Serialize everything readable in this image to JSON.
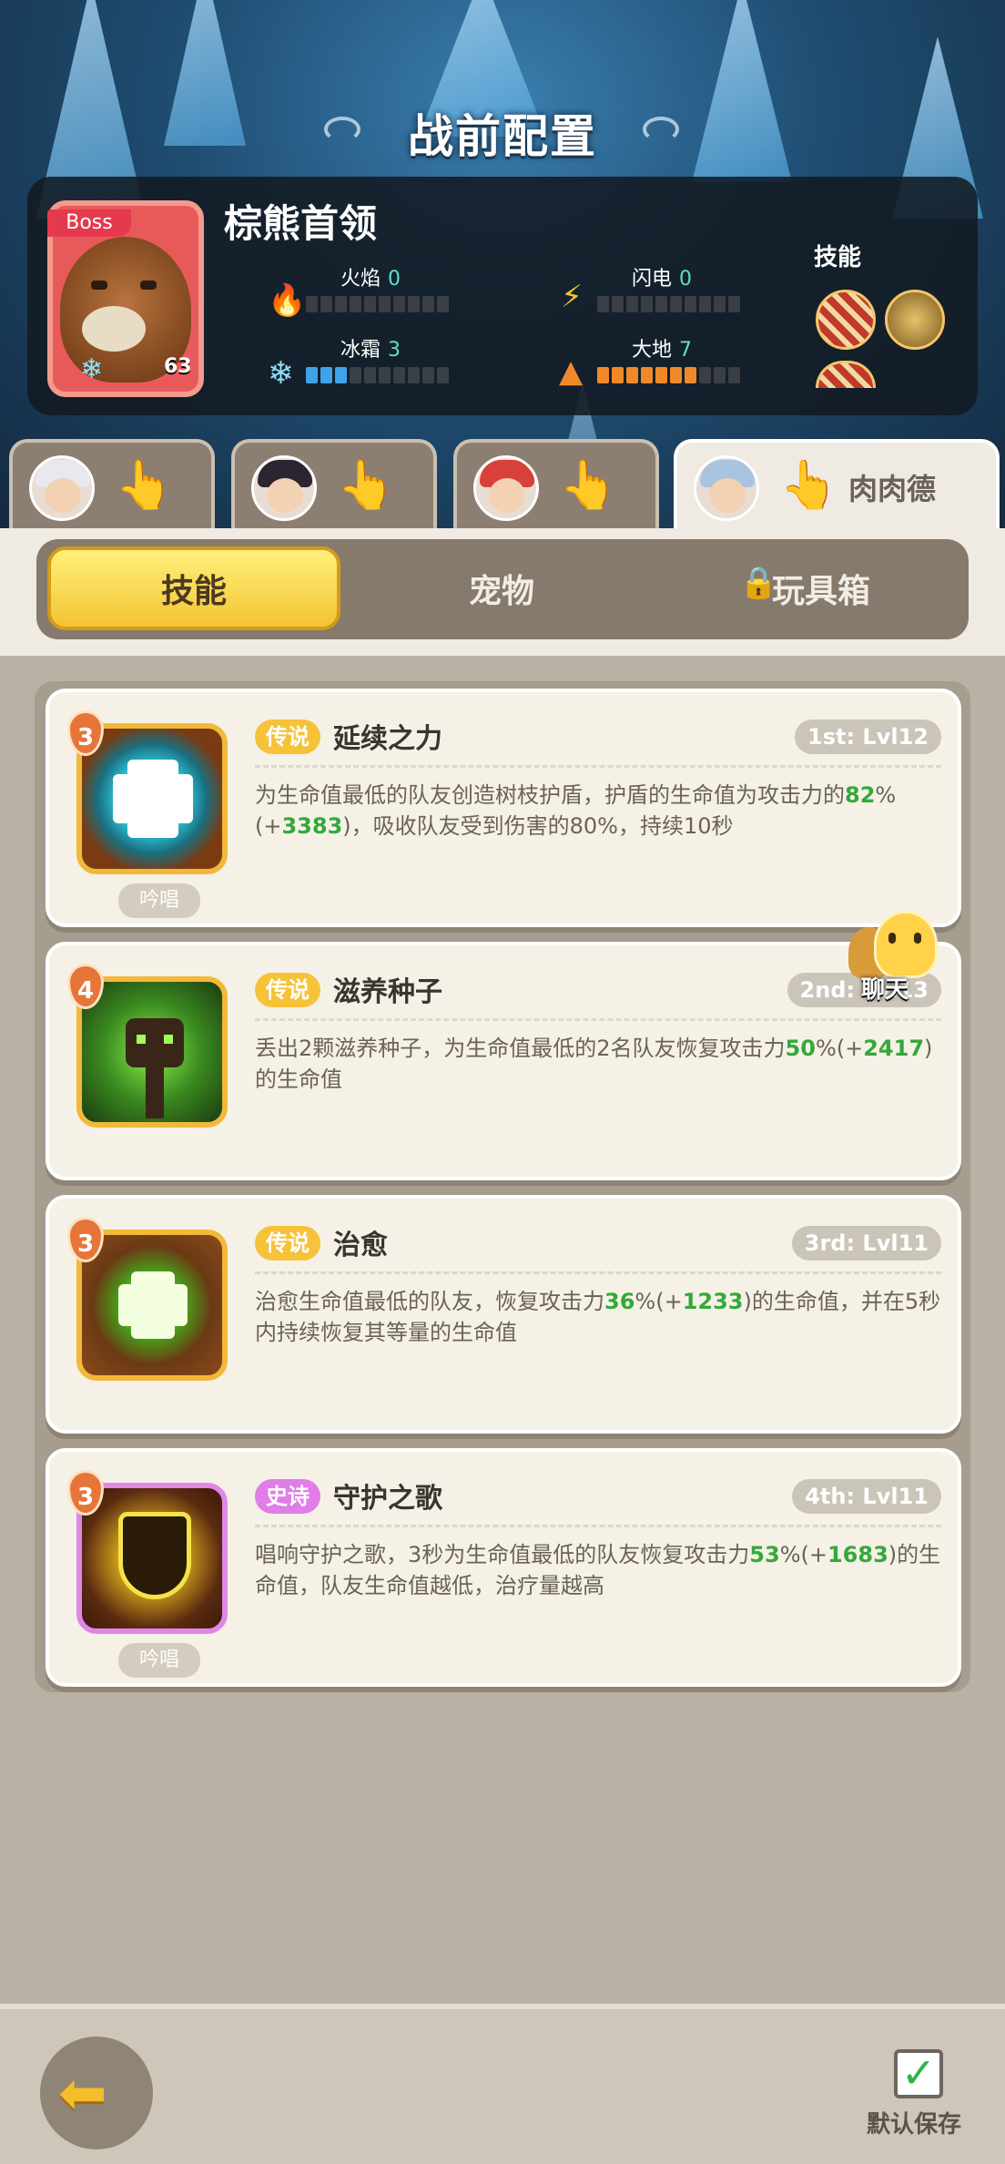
{
  "title": "战前配置",
  "boss": {
    "badge": "Boss",
    "name": "棕熊首领",
    "level": "63",
    "elements": {
      "fire": {
        "label": "火焰",
        "value": "0"
      },
      "lightning": {
        "label": "闪电",
        "value": "0"
      },
      "frost": {
        "label": "冰霜",
        "value": "3"
      },
      "earth": {
        "label": "大地",
        "value": "7"
      }
    },
    "skills_label": "技能"
  },
  "hero_tabs": [
    {
      "active": false
    },
    {
      "active": false
    },
    {
      "active": false
    },
    {
      "active": true,
      "name": "肉肉德"
    }
  ],
  "sub_tabs": {
    "skills": "技能",
    "pets": "宠物",
    "toybox": "玩具箱"
  },
  "skills": [
    {
      "level": "3",
      "rarity": "传说",
      "name": "延续之力",
      "slot": "1st: Lvl12",
      "chant": "吟唱",
      "desc": [
        "为生命值最低的队友创造树枝护盾，护盾的生命值为攻击力的",
        "82",
        "%(+",
        "3383",
        ")，吸收队友受到伤害的80%，持续10秒"
      ]
    },
    {
      "level": "4",
      "rarity": "传说",
      "name": "滋养种子",
      "slot": "2nd: Lvl13",
      "chant": "",
      "desc": [
        "丢出2颗滋养种子，为生命值最低的2名队友恢复攻击力",
        "50",
        "%(+",
        "2417",
        ")的生命值"
      ]
    },
    {
      "level": "3",
      "rarity": "传说",
      "name": "治愈",
      "slot": "3rd: Lvl11",
      "chant": "",
      "desc": [
        "治愈生命值最低的队友，恢复攻击力",
        "36",
        "%(+",
        "1233",
        ")的生命值，并在5秒内持续恢复其等量的生命值"
      ]
    },
    {
      "level": "3",
      "rarity": "史诗",
      "name": "守护之歌",
      "slot": "4th: Lvl11",
      "chant": "吟唱",
      "desc": [
        "唱响守护之歌，3秒为生命值最低的队友恢复攻击力",
        "53",
        "%(+",
        "1683",
        ")的生命值，队友生命值越低，治疗量越高"
      ]
    }
  ],
  "chat_label": "聊天",
  "save_label": "默认保存",
  "colors": {
    "gold": "#f4c433",
    "epic": "#e07de8",
    "green": "#35a83a"
  }
}
